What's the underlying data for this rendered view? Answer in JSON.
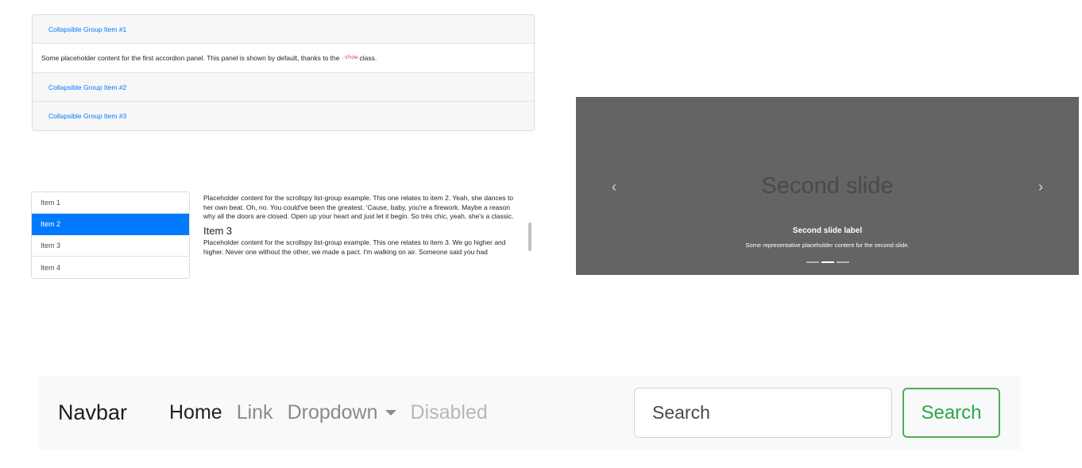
{
  "accordion": {
    "items": [
      {
        "label": "Collapsible Group Item #1"
      },
      {
        "label": "Collapsible Group Item #2"
      },
      {
        "label": "Collapsible Group Item #3"
      }
    ],
    "open_body": {
      "text_before": "Some placeholder content for the first accordion panel. This panel is shown by default, thanks to the",
      "code": ".show",
      "text_after": "class."
    }
  },
  "scrollspy": {
    "items": [
      {
        "label": "Item 1"
      },
      {
        "label": "Item 2"
      },
      {
        "label": "Item 3"
      },
      {
        "label": "Item 4"
      }
    ],
    "active_item": "Item 2",
    "paragraph_item2": "Placeholder content for the scrollspy list-group example. This one relates to item 2. Yeah, she dances to her own beat. Oh, no. You could've been the greatest. 'Cause, baby, you're a firework. Maybe a reason why all the doors are closed. Open up your heart and just let it begin. So très chic, yeah, she's a classic.",
    "heading_item3": "Item 3",
    "paragraph_item3": "Placeholder content for the scrollspy list-group example. This one relates to item 3. We go higher and higher. Never one without the other, we made a pact. I'm walking on air. Someone said you had"
  },
  "carousel": {
    "slide_title": "Second slide",
    "caption_title": "Second slide label",
    "caption_text": "Some representative placeholder content for the second slide.",
    "prev_icon": "‹",
    "next_icon": "›",
    "indicator_count": 3,
    "active_indicator": 2,
    "background_color": "#646464"
  },
  "navbar": {
    "brand": "Navbar",
    "links": {
      "home": "Home",
      "link": "Link",
      "dropdown": "Dropdown",
      "disabled": "Disabled"
    },
    "search_placeholder": "Search",
    "search_button": "Search",
    "accent_color": "#28a745"
  }
}
